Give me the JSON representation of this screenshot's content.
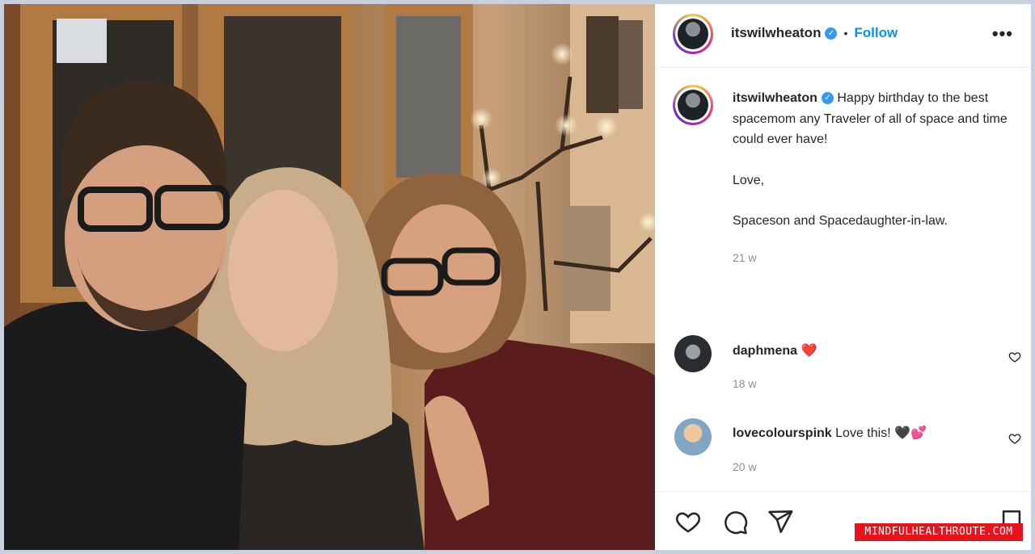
{
  "post": {
    "author": "itswilwheaton",
    "verified_badge": "✓",
    "separator": "•",
    "follow_label": "Follow",
    "more_label": "•••"
  },
  "caption": {
    "author": "itswilwheaton",
    "lines": [
      "Happy birthday to the best spacemom any Traveler of all of space and time could ever have!",
      "Love,",
      "Spaceson and Spacedaughter-in-law."
    ],
    "time": "21 w"
  },
  "comments": [
    {
      "author": "daphmena",
      "text": "",
      "emoji": "❤️",
      "time": "18 w"
    },
    {
      "author": "lovecolourspink",
      "text": "Love this!",
      "emoji": "🖤💕",
      "time": "20 w"
    }
  ],
  "actions": {
    "like_icon": "heart-icon",
    "comment_icon": "comment-icon",
    "share_icon": "send-icon",
    "save_icon": "bookmark-icon"
  },
  "watermark": "MINDFULHEALTHROUTE.COM",
  "colors": {
    "follow": "#0095f6",
    "verified": "#3897f0",
    "watermark_bg": "#e8141b"
  }
}
